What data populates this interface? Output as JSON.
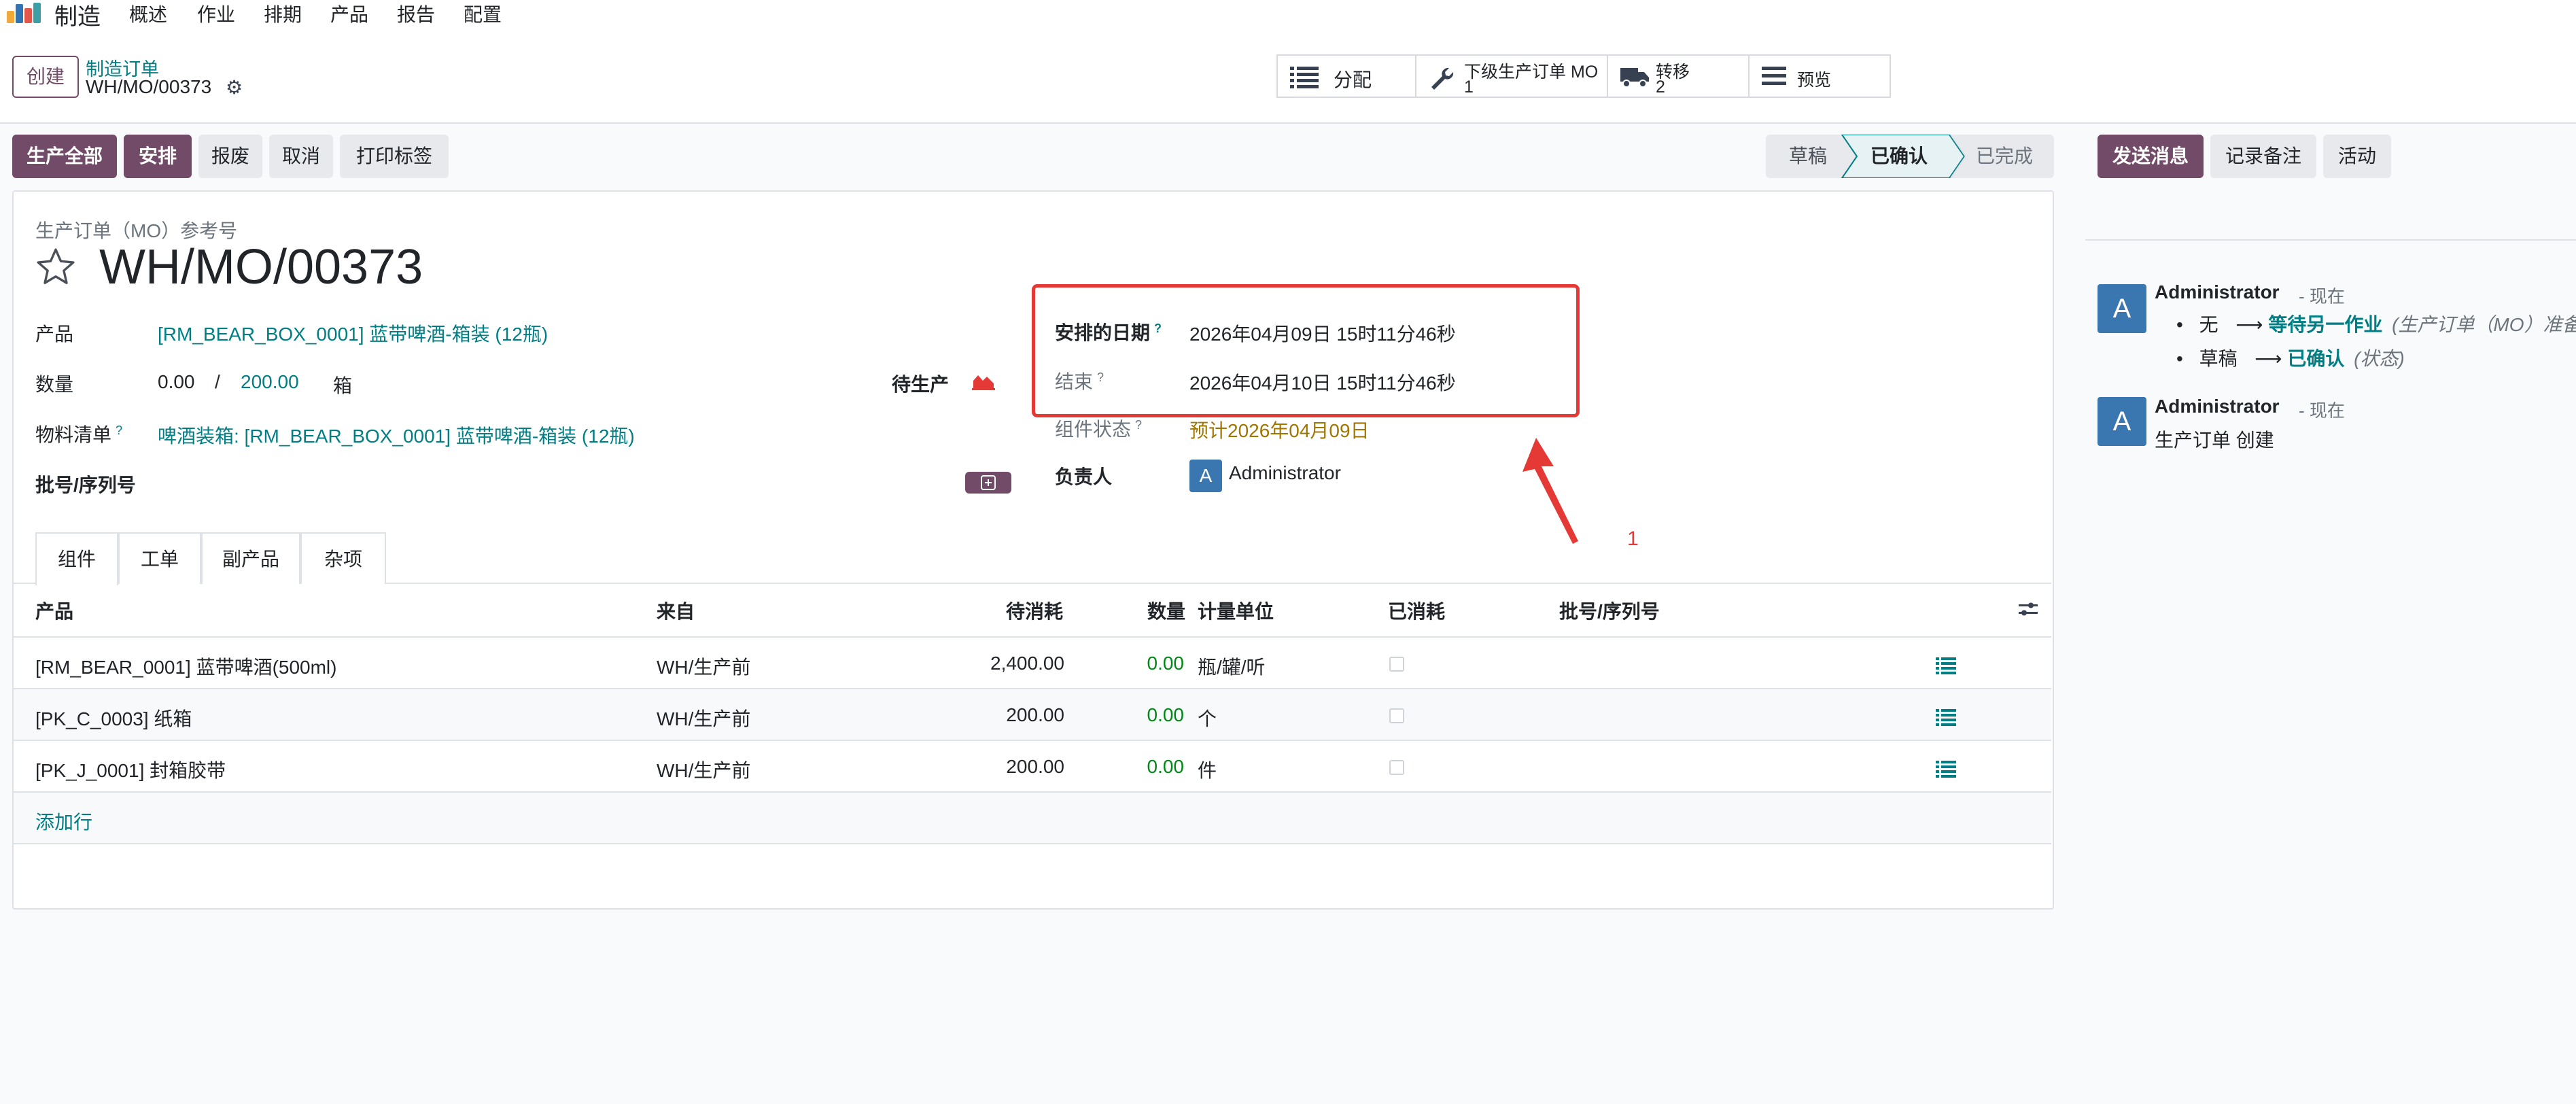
{
  "nav": {
    "app_title": "制造",
    "items": [
      "概述",
      "作业",
      "排期",
      "产品",
      "报告",
      "配置"
    ]
  },
  "control": {
    "create_label": "创建",
    "breadcrumb_parent": "制造订单",
    "record_name": "WH/MO/00373",
    "smart_buttons": [
      {
        "icon": "list-icon",
        "label": "分配",
        "count": ""
      },
      {
        "icon": "wrench-icon",
        "label": "下级生产订单 MO",
        "count": "1"
      },
      {
        "icon": "truck-icon",
        "label": "转移",
        "count": "2"
      },
      {
        "icon": "menu-icon",
        "label": "预览",
        "count": ""
      }
    ]
  },
  "actions": {
    "produce_all": "生产全部",
    "plan": "安排",
    "scrap": "报废",
    "cancel": "取消",
    "print_labels": "打印标签"
  },
  "statusbar": {
    "stages": [
      "草稿",
      "已确认",
      "已完成"
    ],
    "active": "已确认"
  },
  "form": {
    "ref_label": "生产订单（MO）参考号",
    "title": "WH/MO/00373",
    "product_label": "产品",
    "product_value": "[RM_BEAR_BOX_0001] 蓝带啤酒-箱装 (12瓶)",
    "quantity_label": "数量",
    "qty_produced": "0.00",
    "qty_sep": "/",
    "qty_total": "200.00",
    "qty_uom": "箱",
    "to_produce_label": "待生产",
    "bom_label": "物料清单",
    "bom_value": "啤酒装箱: [RM_BEAR_BOX_0001] 蓝带啤酒-箱装 (12瓶)",
    "lot_label": "批号/序列号",
    "scheduled_label": "安排的日期",
    "scheduled_value": "2026年04月09日 15时11分46秒",
    "end_label": "结束",
    "end_value": "2026年04月10日 15时11分46秒",
    "component_status_label": "组件状态",
    "component_status_value": "预计2026年04月09日",
    "responsible_label": "负责人",
    "responsible_avatar": "A",
    "responsible_value": "Administrator",
    "annotation_number": "1"
  },
  "tabs": [
    "组件",
    "工单",
    "副产品",
    "杂项"
  ],
  "table": {
    "headers": [
      "产品",
      "来自",
      "待消耗",
      "数量",
      "计量单位",
      "已消耗",
      "批号/序列号"
    ],
    "rows": [
      {
        "product": "[RM_BEAR_0001] 蓝带啤酒(500ml)",
        "from": "WH/生产前",
        "to_consume": "2,400.00",
        "quantity": "0.00",
        "uom": "瓶/罐/听"
      },
      {
        "product": "[PK_C_0003] 纸箱",
        "from": "WH/生产前",
        "to_consume": "200.00",
        "quantity": "0.00",
        "uom": "个"
      },
      {
        "product": "[PK_J_0001] 封箱胶带",
        "from": "WH/生产前",
        "to_consume": "200.00",
        "quantity": "0.00",
        "uom": "件"
      }
    ],
    "add_line": "添加行"
  },
  "chatter": {
    "send_message": "发送消息",
    "log_note": "记录备注",
    "activities": "活动",
    "messages": [
      {
        "avatar": "A",
        "author": "Administrator",
        "time": "- 现在",
        "changes": [
          {
            "old": "无",
            "arrow": "⟶",
            "new": "等待另一作业",
            "field": "(生产订单（MO）准备就绪)"
          },
          {
            "old": "草稿",
            "arrow": "⟶",
            "new": "已确认",
            "field": "(状态)"
          }
        ]
      },
      {
        "avatar": "A",
        "author": "Administrator",
        "time": "- 现在",
        "body": "生产订单 创建"
      }
    ]
  },
  "colors": {
    "primary": "#714b67",
    "link": "#017e84",
    "highlight_red": "#e53935",
    "warning_text": "#a07500",
    "avatar": "#3a77b0",
    "green": "#008818"
  }
}
